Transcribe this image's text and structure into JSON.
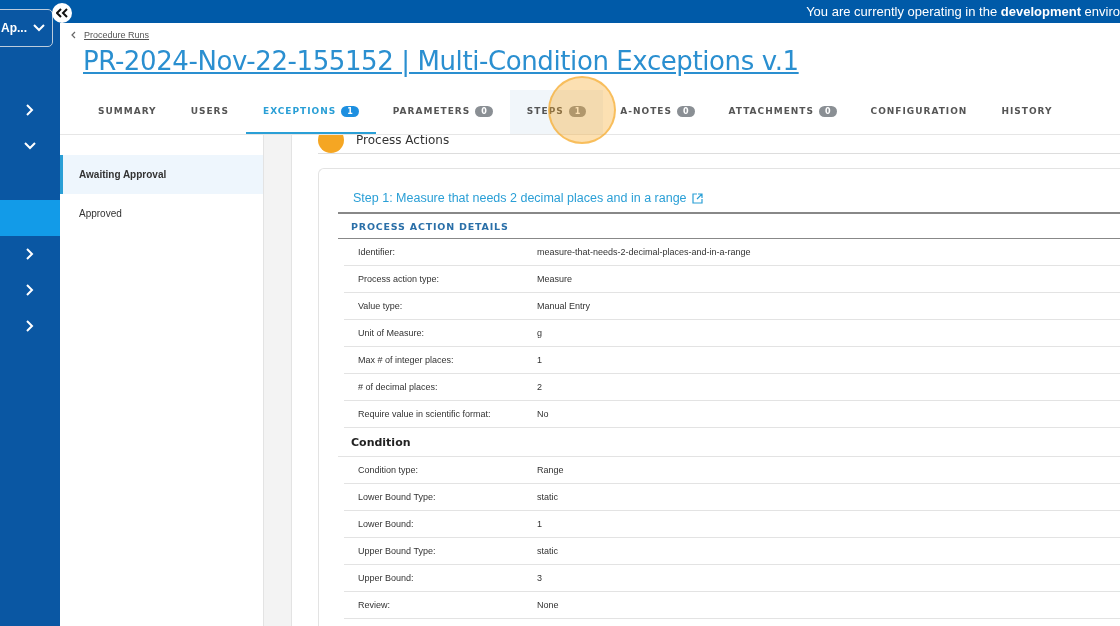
{
  "banner": {
    "text": "You are currently operating in the **development** enviro"
  },
  "app_switcher": {
    "label": "Ap..."
  },
  "sidebar": {
    "items": [
      {
        "kind": "group",
        "expanded": false,
        "selected": false
      },
      {
        "kind": "group",
        "expanded": true,
        "selected": false,
        "children": [
          {
            "selected": true
          }
        ]
      },
      {
        "kind": "group",
        "expanded": false,
        "selected": false
      },
      {
        "kind": "group",
        "expanded": false,
        "selected": false
      },
      {
        "kind": "group",
        "expanded": false,
        "selected": false
      }
    ]
  },
  "breadcrumb": {
    "label": "Procedure Runs"
  },
  "title": "PR-2024-Nov-22-155152 | Multi-Condition Exceptions v.1",
  "tabs": [
    {
      "label": "SUMMARY",
      "selected": false,
      "hovered": false
    },
    {
      "label": "USERS",
      "selected": false,
      "hovered": false
    },
    {
      "label": "EXCEPTIONS",
      "count": "1",
      "selected": true,
      "hovered": false
    },
    {
      "label": "PARAMETERS",
      "count": "0",
      "selected": false,
      "hovered": false
    },
    {
      "label": "STEPS",
      "count": "1",
      "selected": false,
      "hovered": true
    },
    {
      "label": "A-NOTES",
      "count": "0",
      "selected": false,
      "hovered": false
    },
    {
      "label": "ATTACHMENTS",
      "count": "0",
      "selected": false,
      "hovered": false
    },
    {
      "label": "CONFIGURATION",
      "selected": false,
      "hovered": false
    },
    {
      "label": "HISTORY",
      "selected": false,
      "hovered": false
    }
  ],
  "filter_list": [
    {
      "label": "Awaiting Approval",
      "selected": true
    },
    {
      "label": "Approved",
      "selected": false
    }
  ],
  "section_heading": "Process Actions",
  "step": {
    "title": "Step 1: Measure that needs 2 decimal places and in a range",
    "details_heading": "PROCESS ACTION DETAILS",
    "details": [
      {
        "label": "Identifier:",
        "value": "measure-that-needs-2-decimal-places-and-in-a-range"
      },
      {
        "label": "Process action type:",
        "value": "Measure"
      },
      {
        "label": "Value type:",
        "value": "Manual Entry"
      },
      {
        "label": "Unit of Measure:",
        "value": "g"
      },
      {
        "label": "Max # of integer places:",
        "value": "1"
      },
      {
        "label": "# of decimal places:",
        "value": "2"
      },
      {
        "label": "Require value in scientific format:",
        "value": "No"
      }
    ],
    "condition_heading": "Condition",
    "condition": [
      {
        "label": "Condition type:",
        "value": "Range"
      },
      {
        "label": "Lower Bound Type:",
        "value": "static"
      },
      {
        "label": "Lower Bound:",
        "value": "1"
      },
      {
        "label": "Upper Bound Type:",
        "value": "static"
      },
      {
        "label": "Upper Bound:",
        "value": "3"
      },
      {
        "label": "Review:",
        "value": "None"
      }
    ]
  }
}
